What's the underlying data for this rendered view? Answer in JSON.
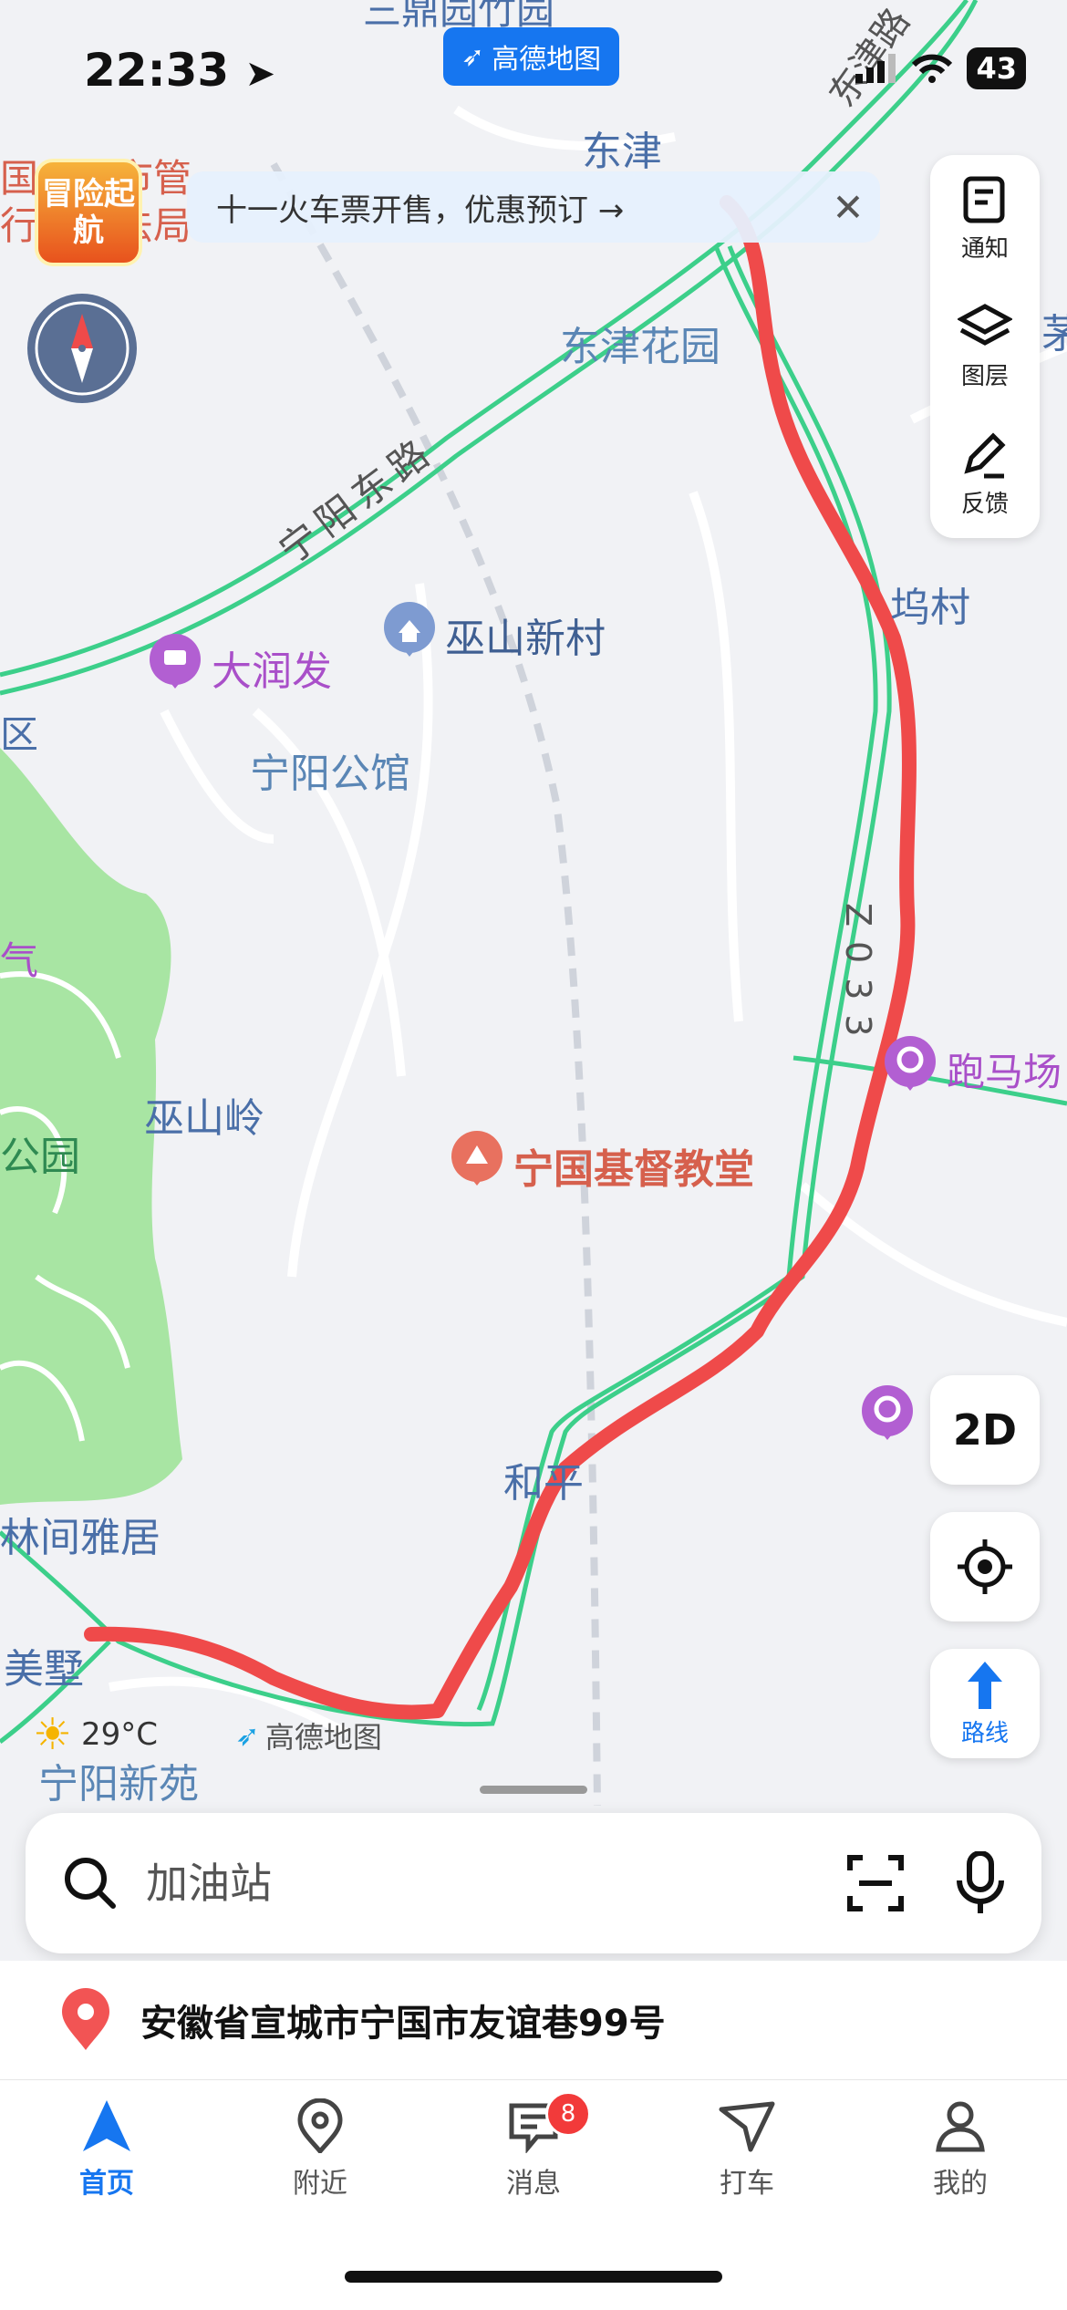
{
  "status_bar": {
    "time": "22:33",
    "battery": "43"
  },
  "top_logo": "高德地图",
  "banner": {
    "text": "十一火车票开售，优惠预订 →"
  },
  "promo_badge": "冒险起航",
  "map_labels": {
    "dongjin": "东津",
    "dongjin_garden": "东津花园",
    "ningyang_east_road": "宁阳东路",
    "dongjin_road_top": "东津路",
    "wushan_village": "巫山新村",
    "darunfa": "大润发",
    "ningyang_mansion": "宁阳公馆",
    "wucun": "坞村",
    "wushanling": "巫山岭",
    "church": "宁国基督教堂",
    "paomachang": "跑马场",
    "heping": "和平",
    "linjianyaju": "林间雅居",
    "meishu": "美墅",
    "ningyang_xinyuan": "宁阳新苑",
    "road_z033": "Z033",
    "left_edge_qu": "区",
    "left_edge_qi": "气",
    "left_edge_gongyuan": "公园",
    "top_left_cut": "国市城市管",
    "top_left_cut2": "行政执法局",
    "right_edge_cut": "茅",
    "top_cut": "三鼎园竹园"
  },
  "tools": {
    "notice": "通知",
    "layers": "图层",
    "feedback": "反馈"
  },
  "mode_2d": "2D",
  "route_button": "路线",
  "weather": {
    "temp": "29°C"
  },
  "watermark": "高德地图",
  "search": {
    "placeholder": "加油站"
  },
  "address": "安徽省宣城市宁国市友谊巷99号",
  "tabs": [
    {
      "label": "首页",
      "active": true
    },
    {
      "label": "附近"
    },
    {
      "label": "消息",
      "badge": "8"
    },
    {
      "label": "打车"
    },
    {
      "label": "我的"
    }
  ],
  "colors": {
    "accent": "#1676f0",
    "route": "#ef4a4a",
    "road": "#3ccf8a",
    "park": "#a8e5a3"
  }
}
